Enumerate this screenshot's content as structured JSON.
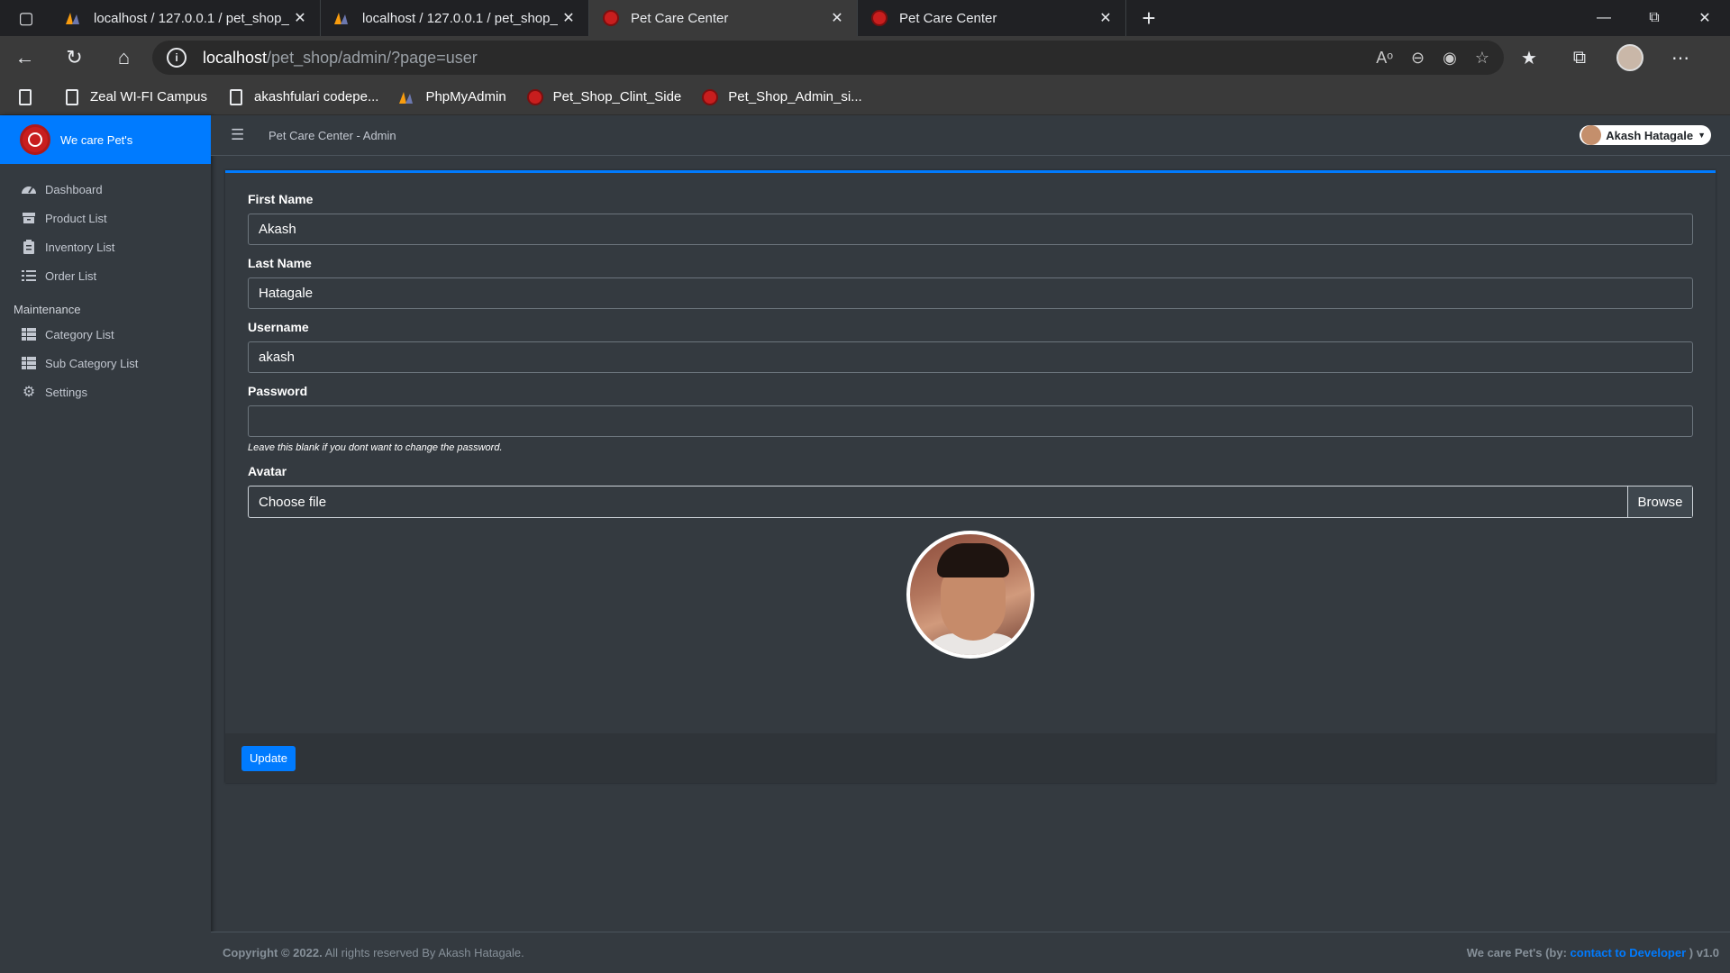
{
  "browser": {
    "tabs": [
      {
        "title": "localhost / 127.0.0.1 / pet_shop_",
        "icon": "phpmyadmin-icon",
        "active": false
      },
      {
        "title": "localhost / 127.0.0.1 / pet_shop_",
        "icon": "phpmyadmin-icon",
        "active": false
      },
      {
        "title": "Pet Care Center",
        "icon": "pet-logo-icon",
        "active": true
      },
      {
        "title": "Pet Care Center",
        "icon": "pet-logo-icon",
        "active": false
      }
    ],
    "url_host": "localhost",
    "url_path": "/pet_shop/admin/?page=user",
    "bookmarks": [
      {
        "label": "Zeal WI-FI Campus",
        "icon": "document-icon"
      },
      {
        "label": "akashfulari codepe...",
        "icon": "document-icon"
      },
      {
        "label": "PhpMyAdmin",
        "icon": "phpmyadmin-icon"
      },
      {
        "label": "Pet_Shop_Clint_Side",
        "icon": "pet-logo-icon"
      },
      {
        "label": "Pet_Shop_Admin_si...",
        "icon": "pet-logo-icon"
      }
    ]
  },
  "sidebar": {
    "brand": "We care Pet's",
    "items": [
      {
        "label": "Dashboard",
        "icon": "tachometer-icon"
      },
      {
        "label": "Product List",
        "icon": "box-icon"
      },
      {
        "label": "Inventory List",
        "icon": "clipboard-list-icon"
      },
      {
        "label": "Order List",
        "icon": "list-icon"
      }
    ],
    "section_header": "Maintenance",
    "maintenance_items": [
      {
        "label": "Category List",
        "icon": "table-icon"
      },
      {
        "label": "Sub Category List",
        "icon": "table-icon"
      },
      {
        "label": "Settings",
        "icon": "cogs-icon"
      }
    ]
  },
  "topbar": {
    "title": "Pet Care Center - Admin",
    "user_name": "Akash Hatagale"
  },
  "form": {
    "first_name_label": "First Name",
    "first_name_value": "Akash",
    "last_name_label": "Last Name",
    "last_name_value": "Hatagale",
    "username_label": "Username",
    "username_value": "akash",
    "password_label": "Password",
    "password_value": "",
    "password_hint": "Leave this blank if you dont want to change the password.",
    "avatar_label": "Avatar",
    "file_placeholder": "Choose file",
    "browse_label": "Browse",
    "update_label": "Update"
  },
  "footer": {
    "copyright_bold": "Copyright © 2022.",
    "copyright_text": " All rights reserved By Akash Hatagale.",
    "right_prefix": "We care Pet's (by: ",
    "right_link": "contact to Developer",
    "right_suffix": " ) v1.0"
  },
  "colors": {
    "accent": "#007bff",
    "sidebar_bg": "#343a40",
    "content_bg": "#343a40"
  }
}
